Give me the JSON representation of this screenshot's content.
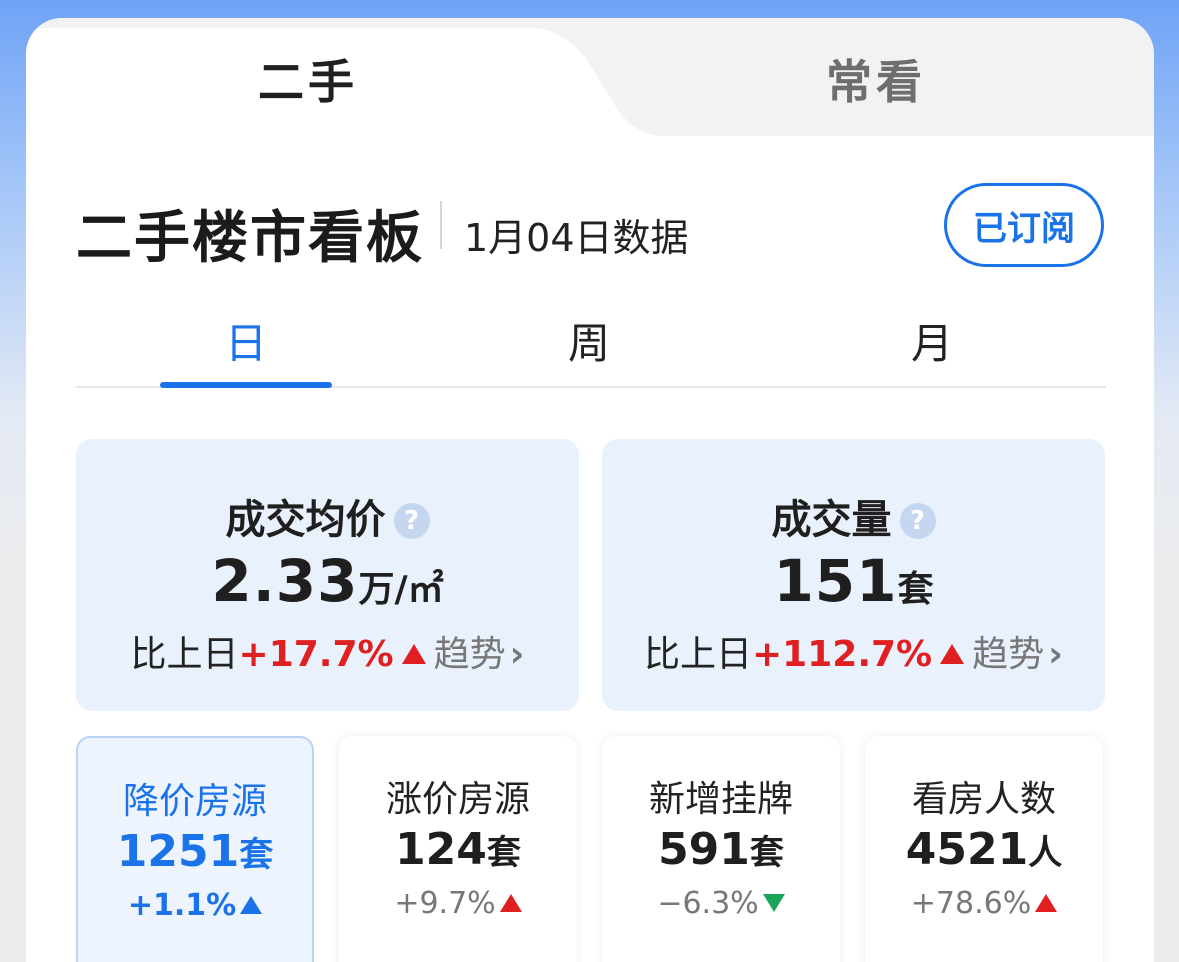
{
  "top_tabs": [
    {
      "label": "二手"
    },
    {
      "label": "常看"
    }
  ],
  "header": {
    "title": "二手楼市看板",
    "data_date": "1月04日数据",
    "subscribe_label": "已订阅"
  },
  "period_tabs": [
    {
      "label": "日"
    },
    {
      "label": "周"
    },
    {
      "label": "月"
    }
  ],
  "big_cards": [
    {
      "title": "成交均价",
      "help": "?",
      "value": "2.33",
      "unit": "万/㎡",
      "compare_label": "比上日",
      "change": "+17.7%",
      "trend_label": "趋势"
    },
    {
      "title": "成交量",
      "help": "?",
      "value": "151",
      "unit": "套",
      "compare_label": "比上日",
      "change": "+112.7%",
      "trend_label": "趋势"
    }
  ],
  "small_cards": [
    {
      "label": "降价房源",
      "value": "1251",
      "unit": "套",
      "change": "+1.1%",
      "direction": "up"
    },
    {
      "label": "涨价房源",
      "value": "124",
      "unit": "套",
      "change": "+9.7%",
      "direction": "up"
    },
    {
      "label": "新增挂牌",
      "value": "591",
      "unit": "套",
      "change": "−6.3%",
      "direction": "down"
    },
    {
      "label": "看房人数",
      "value": "4521",
      "unit": "人",
      "change": "+78.6%",
      "direction": "up"
    }
  ],
  "colors": {
    "accent": "#1a73e8",
    "up": "#e02020",
    "down": "#1aa65a",
    "card_bg": "#e9f1fd"
  },
  "icons": {
    "help": "question-circle-icon",
    "chevron": "chevron-right-icon",
    "up": "triangle-up-icon",
    "down": "triangle-down-icon"
  }
}
